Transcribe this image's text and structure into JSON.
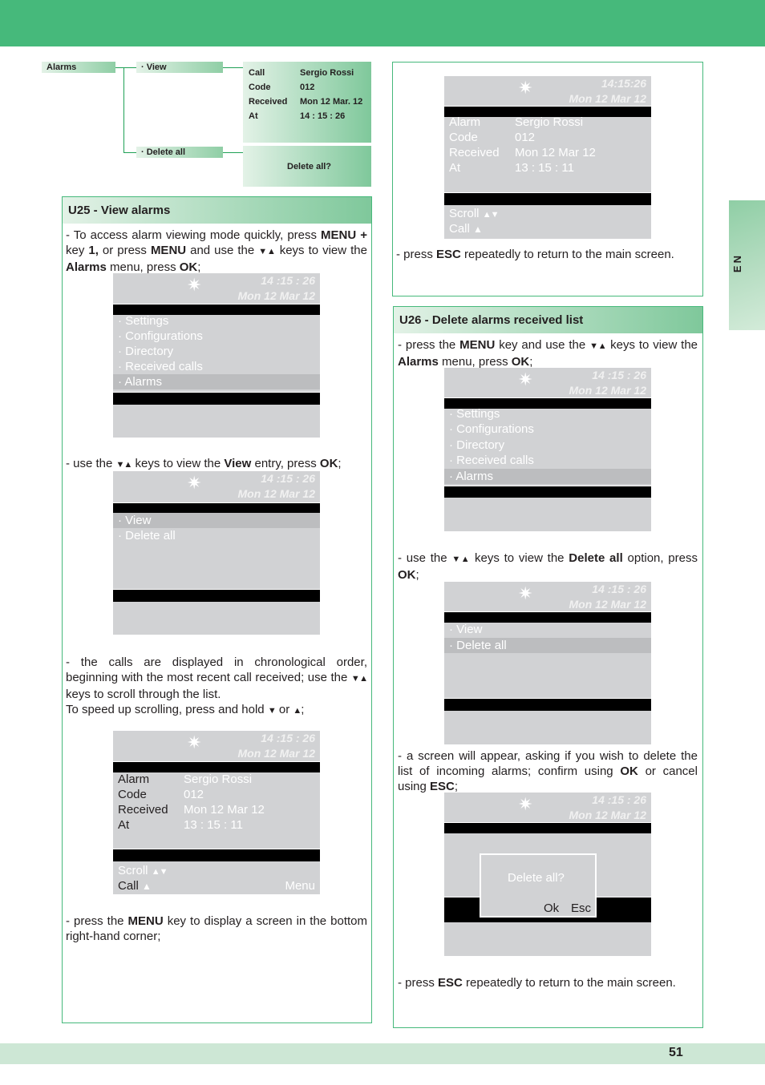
{
  "page": {
    "number": "51",
    "language_tab": "EN"
  },
  "tree": {
    "root": "Alarms",
    "view": "· View",
    "delete_all": "· Delete all",
    "view_panel": [
      {
        "label": "Call",
        "value": "Sergio Rossi"
      },
      {
        "label": "Code",
        "value": "012"
      },
      {
        "label": "Received",
        "value": "Mon 12 Mar. 12"
      },
      {
        "label": "At",
        "value": "14 : 15 : 26"
      }
    ],
    "delete_panel": "Delete all?"
  },
  "u25": {
    "title": "U25 - View alarms",
    "p1": [
      "- To access alarm viewing mode quickly, press ",
      "MENU",
      " + ",
      "key ",
      "1,",
      " or press ",
      "MENU",
      " and use the ",
      " keys to view the ",
      "Alarms",
      " menu, press ",
      "OK",
      ";"
    ],
    "p2": [
      "- use the ",
      " keys to view the ",
      "View",
      " entry, press ",
      "OK",
      ";"
    ],
    "p3": [
      "- the calls are displayed in chronological order, beginning with the most recent call received; use the ",
      " keys to scroll through the list.",
      "To speed up scrolling, press and hold ",
      " or ",
      ";"
    ],
    "p4": [
      "- press the ",
      "MENU",
      " key to display a screen in the bottom right-hand corner;"
    ]
  },
  "u26": {
    "title": "U26 -  Delete alarms received list",
    "p1": [
      "- press the ",
      "MENU",
      " key and use the ",
      " keys to view the ",
      "Alarms",
      " menu, press ",
      "OK",
      ";"
    ],
    "p2": [
      "- use the ",
      " keys to view the ",
      "Delete all",
      " option, press ",
      "OK",
      ";"
    ],
    "p3": [
      "- a screen will appear, asking if you wish to delete the list of incoming alarms; confirm using ",
      "OK",
      " or cancel using ",
      "ESC",
      ";"
    ],
    "p4": [
      "- press ",
      "ESC",
      " repeatedly to return to the main screen."
    ]
  },
  "top_right": {
    "p1": [
      "- press ",
      "ESC",
      " repeatedly to return to the main screen."
    ]
  },
  "lcd": {
    "time": "14 :15 : 26",
    "time_alt": "14:15:26",
    "date": "Mon 12 Mar 12",
    "main_menu": [
      "· Settings",
      "· Configurations",
      "· Directory",
      "· Received calls",
      "· Alarms"
    ],
    "main_menu_selected": 4,
    "alarms_menu": [
      "· View",
      "· Delete all"
    ],
    "detail": [
      {
        "label": "Alarm",
        "value": "Sergio Rossi"
      },
      {
        "label": "Code",
        "value": "012"
      },
      {
        "label": "Received",
        "value": "Mon 12 Mar 12"
      },
      {
        "label": "At",
        "value": "13 : 15 : 11"
      }
    ],
    "scroll": "Scroll",
    "call": "Call",
    "menu": "Menu",
    "dialog_text": "Delete all?",
    "ok": "Ok",
    "esc": "Esc"
  },
  "icons": {
    "sun": "✷",
    "down": "▼",
    "up": "▲",
    "bell": "🔔"
  }
}
